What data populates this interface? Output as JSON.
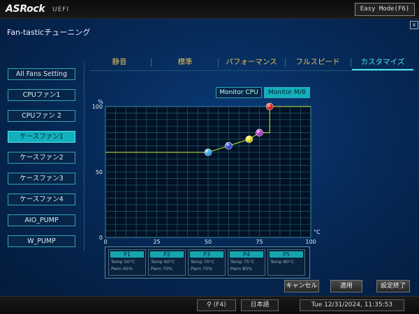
{
  "brand": {
    "logo": "ASRock",
    "sub": "UEFI"
  },
  "top": {
    "easy_mode": "Easy Mode(F6)"
  },
  "page": {
    "title": "Fan-tasticチューニング",
    "close": "x"
  },
  "tabs": [
    "静音",
    "標準",
    "パフォーマンス",
    "フルスピード",
    "カスタマイズ"
  ],
  "active_tab": "カスタマイズ",
  "sidebar": [
    "All Fans Setting",
    "CPUファン1",
    "CPUファン 2",
    "ケースファン1",
    "ケースファン2",
    "ケースファン3",
    "ケースファン4",
    "AIO_PUMP",
    "W_PUMP"
  ],
  "sidebar_active": "ケースファン1",
  "monitor": {
    "cpu": "Monitor CPU",
    "mb": "Monitor M/B",
    "selected": "Monitor M/B"
  },
  "chart_data": {
    "type": "line",
    "x_unit": "°C",
    "y_unit": "%",
    "xlim": [
      0,
      100
    ],
    "ylim": [
      0,
      100
    ],
    "x_ticks": [
      "0",
      "25",
      "50",
      "75",
      "100"
    ],
    "y_ticks": [
      "50",
      "100"
    ],
    "grid": true,
    "series": [
      {
        "x": [
          0,
          50,
          60,
          70,
          75,
          80,
          80,
          100
        ],
        "y": [
          65,
          65,
          70,
          75,
          80,
          80,
          100,
          100
        ]
      }
    ],
    "points": [
      {
        "name": "P1",
        "x": 50,
        "y": 65,
        "color": "#27a8f0"
      },
      {
        "name": "P2",
        "x": 60,
        "y": 70,
        "color": "#2a3fe0"
      },
      {
        "name": "P3",
        "x": 70,
        "y": 75,
        "color": "#e6e61a"
      },
      {
        "name": "P4",
        "x": 75,
        "y": 80,
        "color": "#b52fd8"
      },
      {
        "name": "P5",
        "x": 80,
        "y": 100,
        "color": "#e21b1b"
      }
    ]
  },
  "points_panel": [
    {
      "name": "P1",
      "temp": "Temp 50°C",
      "pwm": "Pwm  65%"
    },
    {
      "name": "P2",
      "temp": "Temp 60°C",
      "pwm": "Pwm  70%"
    },
    {
      "name": "P3",
      "temp": "Temp 70°C",
      "pwm": "Pwm  75%"
    },
    {
      "name": "P4",
      "temp": "Temp 75°C",
      "pwm": "Pwm  80%"
    },
    {
      "name": "P5",
      "temp": "Temp 80°C",
      "pwm": ""
    }
  ],
  "actions": {
    "cancel": "キャンセル",
    "apply": "適用",
    "finish": "設定終了"
  },
  "footer": {
    "search": "(F4)",
    "language": "日本語",
    "datetime": "Tue 12/31/2024, 11:35:53"
  },
  "colors": {
    "accent": "#52e0ea",
    "tab_inactive": "#e6c35a",
    "curve": "#c8ee3a"
  }
}
